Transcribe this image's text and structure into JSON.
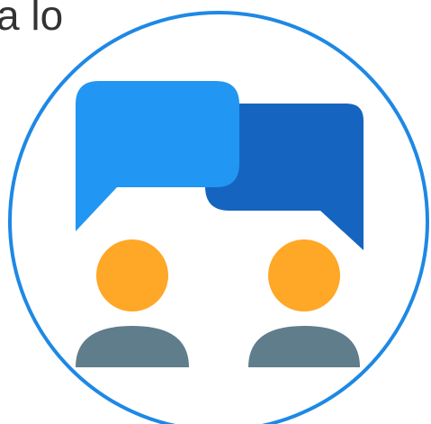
{
  "fragment_text": "a lo",
  "icon": {
    "name": "chat-users-icon",
    "colors": {
      "ring": "#1E88E5",
      "bubble_left": "#2196F3",
      "bubble_right": "#1565C0",
      "head": "#FFA726",
      "body": "#607D8B"
    }
  }
}
